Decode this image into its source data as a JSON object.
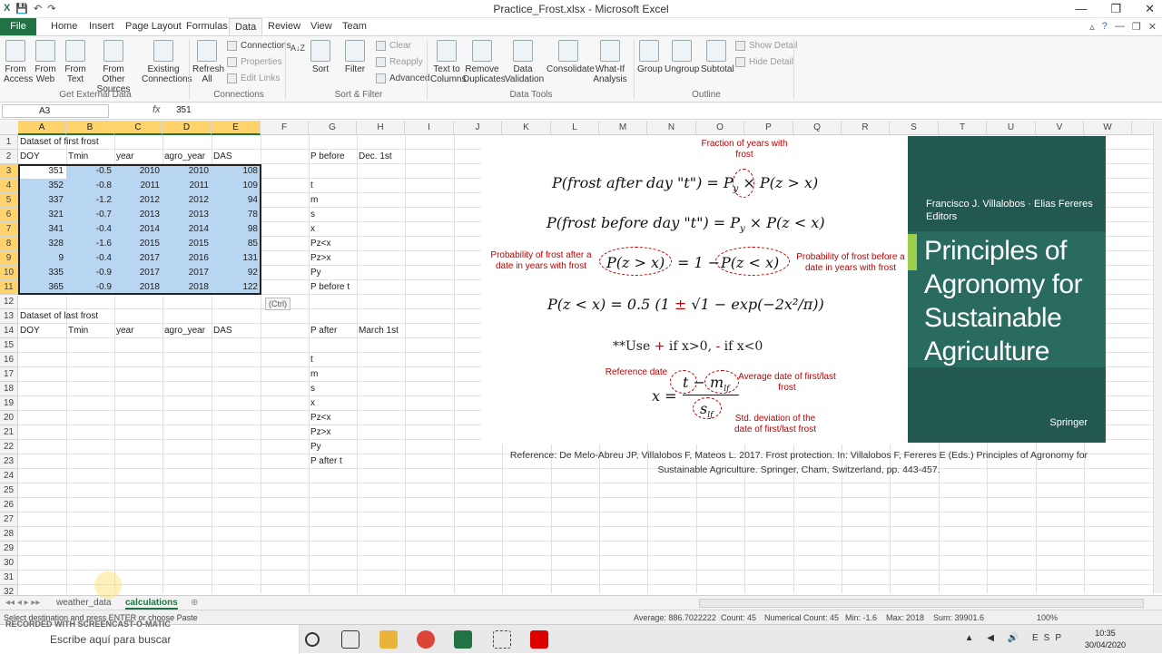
{
  "window": {
    "title": "Practice_Frost.xlsx - Microsoft Excel",
    "min": "—",
    "max": "❐",
    "close": "✕"
  },
  "tabs": [
    "File",
    "Home",
    "Insert",
    "Page Layout",
    "Formulas",
    "Data",
    "Review",
    "View",
    "Team"
  ],
  "ribbon": {
    "from_access": "From Access",
    "from_web": "From Web",
    "from_text": "From Text",
    "from_other": "From Other Sources",
    "existing": "Existing Connections",
    "refresh": "Refresh All",
    "connections": "Connections",
    "properties": "Properties",
    "edit_links": "Edit Links",
    "sort_az": "A↓Z",
    "sort": "Sort",
    "filter": "Filter",
    "clear": "Clear",
    "reapply": "Reapply",
    "advanced": "Advanced",
    "text_to_columns": "Text to Columns",
    "remove_dup": "Remove Duplicates",
    "data_validation": "Data Validation",
    "consolidate": "Consolidate",
    "whatif": "What-If Analysis",
    "group": "Group",
    "ungroup": "Ungroup",
    "subtotal": "Subtotal",
    "show_detail": "Show Detail",
    "hide_detail": "Hide Detail",
    "g_external": "Get External Data",
    "g_connections": "Connections",
    "g_sort": "Sort & Filter",
    "g_tools": "Data Tools",
    "g_outline": "Outline"
  },
  "namebox": "A3",
  "fx": "fx",
  "formula_value": "351",
  "columns": [
    "A",
    "B",
    "C",
    "D",
    "E",
    "F",
    "G",
    "H",
    "I",
    "J",
    "K",
    "L",
    "M",
    "N",
    "O",
    "P",
    "Q",
    "R",
    "S",
    "T",
    "U",
    "V",
    "W"
  ],
  "rows": [
    "1",
    "2",
    "3",
    "4",
    "5",
    "6",
    "7",
    "8",
    "9",
    "10",
    "11",
    "12",
    "13",
    "14",
    "15",
    "16",
    "17",
    "18",
    "19",
    "20",
    "21",
    "22",
    "23",
    "24",
    "25",
    "26",
    "27",
    "28",
    "29",
    "30",
    "31",
    "32"
  ],
  "sheet": {
    "title1": "Dataset of first frost",
    "headers": [
      "DOY",
      "Tmin",
      "year",
      "agro_year",
      "DAS"
    ],
    "data": [
      [
        "351",
        "-0.5",
        "2010",
        "2010",
        "108"
      ],
      [
        "352",
        "-0.8",
        "2011",
        "2011",
        "109"
      ],
      [
        "337",
        "-1.2",
        "2012",
        "2012",
        "94"
      ],
      [
        "321",
        "-0.7",
        "2013",
        "2013",
        "78"
      ],
      [
        "341",
        "-0.4",
        "2014",
        "2014",
        "98"
      ],
      [
        "328",
        "-1.6",
        "2015",
        "2015",
        "85"
      ],
      [
        "9",
        "-0.4",
        "2017",
        "2016",
        "131"
      ],
      [
        "335",
        "-0.9",
        "2017",
        "2017",
        "92"
      ],
      [
        "365",
        "-0.9",
        "2018",
        "2018",
        "122"
      ]
    ],
    "title2": "Dataset of last frost",
    "headers2": [
      "DOY",
      "Tmin",
      "year",
      "agro_year",
      "DAS"
    ],
    "pbefore": "P before",
    "dec1": "Dec. 1st",
    "glist1": [
      "t",
      "m",
      "s",
      "x",
      "Pz<x",
      "Pz>x",
      "Py",
      "P before t"
    ],
    "pafter": "P after",
    "mar1": "March 1st",
    "glist2": [
      "t",
      "m",
      "s",
      "x",
      "Pz<x",
      "Pz>x",
      "Py",
      "P after t"
    ],
    "ctrl": "(Ctrl)"
  },
  "figure": {
    "note_py": "Fraction of years with frost",
    "eq1": "P(frost after day \"t\") = P",
    "eq1b": "× P(z > x)",
    "eq2": "P(frost before day \"t\") = P",
    "eq2b": "× P(z < x)",
    "note_after": "Probability of frost after a date in years with frost",
    "note_before": "Probability of frost before a date in years with frost",
    "eq3a": "P(z > x)",
    "eq3b": "= 1 −",
    "eq3c": "P(z < x)",
    "eq4": "P(z < x) = 0.5 (1",
    "eq4pm": "±",
    "eq4b": "√1 − exp(−2x²/π))",
    "use": "**Use",
    "plus": "+",
    "use2": "if x>0,",
    "minus": "-",
    "use3": "if x<0",
    "note_ref": "Reference date",
    "note_avg": "Average date of first/last frost",
    "note_std": "Std. deviation of the date of first/last frost",
    "x_eq": "x =",
    "t_m": "t − m",
    "lf": "lf",
    "s": "s"
  },
  "book": {
    "authors": "Francisco J. Villalobos · Elias Fereres",
    "editors": "Editors",
    "title": "Principles of Agronomy for Sustainable Agriculture",
    "publisher": "Springer"
  },
  "reference": "Reference: De Melo-Abreu JP, Villalobos F, Mateos L. 2017. Frost protection. In: Villalobos F, Fereres E (Eds.) Principles of Agronomy for Sustainable Agriculture. Springer, Cham, Switzerland, pp. 443-457.",
  "sheets": [
    "weather_data",
    "calculations"
  ],
  "status": {
    "msg": "Select destination and press ENTER or choose Paste",
    "average": "Average: 886.7022222",
    "count": "Count: 45",
    "numcount": "Numerical Count: 45",
    "min": "Min: -1.6",
    "max": "Max: 2018",
    "sum": "Sum: 39901.6",
    "zoom": "100%"
  },
  "taskbar": {
    "search": "Escribe aquí para buscar",
    "lang": "ESP",
    "time": "10:35",
    "date": "30/04/2020",
    "watermark": "RECORDED WITH SCREENCAST-O-MATIC"
  }
}
